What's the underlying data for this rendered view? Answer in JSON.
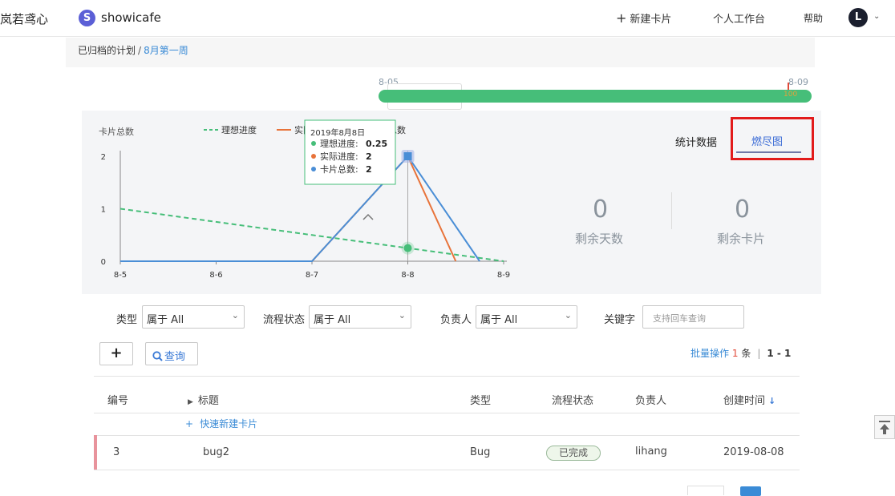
{
  "header": {
    "brand": "岚若鸢心",
    "app_logo_letter": "S",
    "app_name": "showicafe",
    "new_card": "新建卡片",
    "workspace": "个人工作台",
    "help": "帮助",
    "avatar_letter": "L"
  },
  "breadcrumb": {
    "parent": "已归档的计划",
    "separator": "/",
    "current": "8月第一周"
  },
  "timeline": {
    "start": "8-05",
    "end": "8-09",
    "progress_label": "100",
    "progress": 1.0
  },
  "tabs": {
    "stats": "统计数据",
    "burndown": "燃尽图",
    "active": "burndown"
  },
  "stats": {
    "days_left": {
      "value": "0",
      "label": "剩余天数"
    },
    "cards_left": {
      "value": "0",
      "label": "剩余卡片"
    }
  },
  "filters": {
    "type_label": "类型",
    "type_value": "属于 All",
    "status_label": "流程状态",
    "status_value": "属于 All",
    "owner_label": "负责人",
    "owner_value": "属于 All",
    "keyword_label": "关键字",
    "keyword_placeholder": "支持回车查询"
  },
  "toolbar": {
    "add_label": "+",
    "query_label": "查询",
    "batch_label": "批量操作",
    "count": "1",
    "unit": "条",
    "divider": "|",
    "range": "1 - 1"
  },
  "table": {
    "columns": [
      "编号",
      "标题",
      "类型",
      "流程状态",
      "负责人",
      "创建时间"
    ],
    "sort_indicator": "↓",
    "quick_new": "快速新建卡片",
    "rows": [
      {
        "id": "3",
        "title": "bug2",
        "type": "Bug",
        "status": "已完成",
        "owner": "lihang",
        "created": "2019-08-08"
      }
    ]
  },
  "chart_data": {
    "type": "line",
    "ylabel": "卡片总数",
    "x": [
      "8-5",
      "8-6",
      "8-7",
      "8-8",
      "8-9"
    ],
    "y_ticks": [
      "0",
      "1",
      "2"
    ],
    "ylim": [
      0,
      2
    ],
    "legend_position": "top",
    "series": [
      {
        "name": "理想进度",
        "color": "#46be79",
        "dashed": true,
        "points": [
          [
            0,
            1
          ],
          [
            1,
            0.75
          ],
          [
            2,
            0.5
          ],
          [
            3,
            0.25
          ],
          [
            4,
            0
          ]
        ]
      },
      {
        "name": "实际进度",
        "color": "#e8733a",
        "dashed": false,
        "points": [
          [
            0,
            0
          ],
          [
            1,
            0
          ],
          [
            2,
            0
          ],
          [
            3,
            2
          ],
          [
            3.5,
            0
          ]
        ]
      },
      {
        "name": "卡片总数",
        "color": "#4a8ed6",
        "dashed": false,
        "points": [
          [
            0,
            0
          ],
          [
            1,
            0
          ],
          [
            2,
            0
          ],
          [
            3,
            2
          ],
          [
            3.75,
            0
          ]
        ]
      }
    ],
    "tooltip": {
      "title": "2019年8月8日",
      "x_index": 3,
      "items": [
        {
          "name": "理想进度",
          "value": "0.25",
          "color": "#46be79"
        },
        {
          "name": "实际进度",
          "value": "2",
          "color": "#e8733a"
        },
        {
          "name": "卡片总数",
          "value": "2",
          "color": "#4a8ed6"
        }
      ]
    }
  },
  "colors": {
    "accent": "#3a8bd6",
    "progress_bar": "#46be79",
    "highlight": "#e21b1b"
  }
}
